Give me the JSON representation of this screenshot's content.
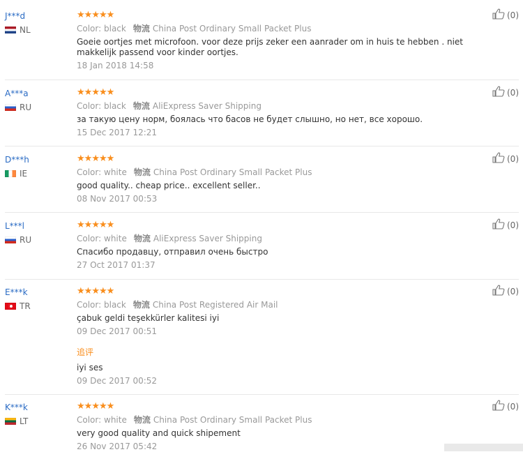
{
  "reviews": [
    {
      "user": "J***d",
      "country": "NL",
      "flag": "nl",
      "color_label": "Color:",
      "color": "black",
      "shipping_icon": "物流",
      "shipping": "China Post Ordinary Small Packet Plus",
      "text": "Goeie oortjes met microfoon. voor deze prijs zeker een aanrader om in huis te hebben . niet makkelijk passend voor kinder oortjes.",
      "date": "18 Jan 2018 14:58",
      "helpful": "(0)",
      "stars": 5
    },
    {
      "user": "A***a",
      "country": "RU",
      "flag": "ru",
      "color_label": "Color:",
      "color": "black",
      "shipping_icon": "物流",
      "shipping": "AliExpress Saver Shipping",
      "text": "за такую цену норм, боялась что басов не будет слышно, но нет, все хорошо.",
      "date": "15 Dec 2017 12:21",
      "helpful": "(0)",
      "stars": 5
    },
    {
      "user": "D***h",
      "country": "IE",
      "flag": "ie",
      "color_label": "Color:",
      "color": "white",
      "shipping_icon": "物流",
      "shipping": "China Post Ordinary Small Packet Plus",
      "text": "good quality.. cheap price.. excellent seller..",
      "date": "08 Nov 2017 00:53",
      "helpful": "(0)",
      "stars": 5
    },
    {
      "user": "L***l",
      "country": "RU",
      "flag": "ru",
      "color_label": "Color:",
      "color": "white",
      "shipping_icon": "物流",
      "shipping": "AliExpress Saver Shipping",
      "text": "Спасибо продавцу, отправил очень быстро",
      "date": "27 Oct 2017 01:37",
      "helpful": "(0)",
      "stars": 5
    },
    {
      "user": "E***k",
      "country": "TR",
      "flag": "tr",
      "color_label": "Color:",
      "color": "black",
      "shipping_icon": "物流",
      "shipping": "China Post Registered Air Mail",
      "text": "çabuk geldi teşekkürler kalitesi iyi",
      "date": "09 Dec 2017 00:51",
      "helpful": "(0)",
      "stars": 5,
      "followup": {
        "label": "追评",
        "text": "iyi ses",
        "date": "09 Dec 2017 00:52"
      }
    },
    {
      "user": "K***k",
      "country": "LT",
      "flag": "lt",
      "color_label": "Color:",
      "color": "white",
      "shipping_icon": "物流",
      "shipping": "China Post Ordinary Small Packet Plus",
      "text": "very good quality and quick shipement",
      "date": "26 Nov 2017 05:42",
      "helpful": "(0)",
      "stars": 5
    }
  ],
  "colors": {
    "username": "#2a6bc4",
    "stars": "#f98e1d",
    "followup_label": "#f98e1d",
    "meta_text": "#999999"
  },
  "icons": {
    "star": "star-icon",
    "flag": "flag-icon",
    "helpful": "thumbs-up-icon"
  }
}
